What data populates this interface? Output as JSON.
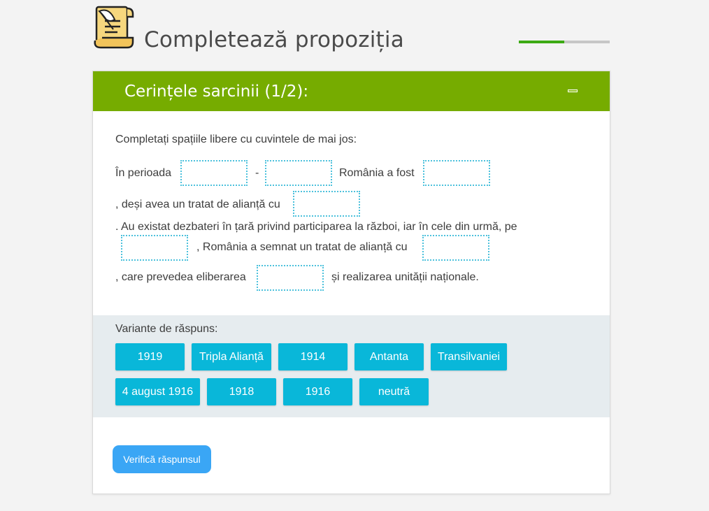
{
  "header": {
    "title": "Completează propoziția",
    "progress_fraction": 0.5
  },
  "card": {
    "title": "Cerințele sarcinii (1/2):",
    "instruction": "Completați spațiile libere cu cuvintele de mai jos:",
    "sentence": {
      "t1": "În perioada",
      "t2": "-",
      "t3": "România a fost",
      "t4": ", deși avea un tratat de alianță cu",
      "t5": ". Au existat dezbateri în țară privind participarea la război, iar în cele din urmă, pe",
      "t6": ", România a semnat un tratat de alianță cu",
      "t7": ", care prevedea eliberarea",
      "t8": "și realizarea unității naționale."
    },
    "options_label": "Variante de răspuns:",
    "options": [
      "1919",
      "Tripla Alianță",
      "1914",
      "Antanta",
      "Transilvaniei",
      "4 august 1916",
      "1918",
      "1916",
      "neutră"
    ],
    "check_button": "Verifică răspunsul"
  },
  "colors": {
    "header_green": "#76ac00",
    "chip_blue": "#09b7d9",
    "button_blue": "#3aa6f5",
    "progress_green": "#3caa14",
    "blank_border": "#4cc1dc"
  }
}
